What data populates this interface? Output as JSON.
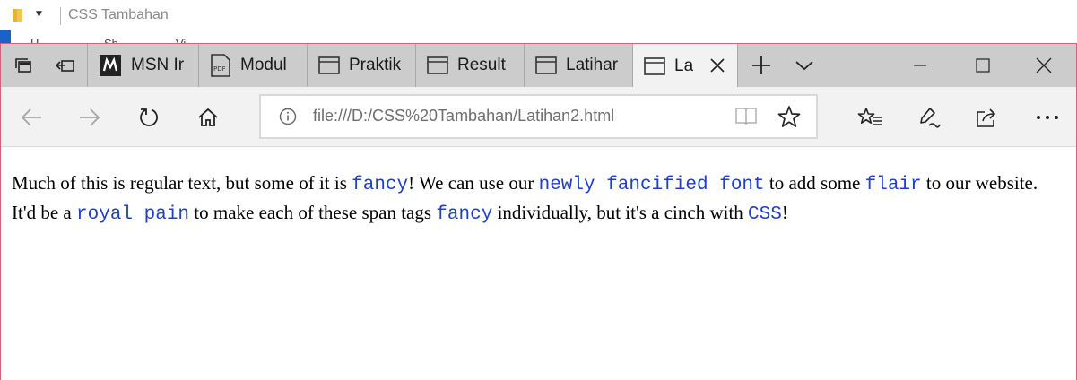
{
  "explorer": {
    "title": "CSS Tambahan",
    "ribbon_peek": [
      "H",
      "Sh",
      "Vi"
    ]
  },
  "tabs": [
    {
      "title": "MSN Ir",
      "icon": "msn-icon"
    },
    {
      "title": "Modul",
      "icon": "pdf-icon"
    },
    {
      "title": "Praktik",
      "icon": "page-icon"
    },
    {
      "title": "Result",
      "icon": "page-icon"
    },
    {
      "title": "Latihar",
      "icon": "page-icon"
    },
    {
      "title": "La",
      "icon": "page-icon",
      "active": true
    }
  ],
  "address": {
    "url": "file:///D:/CSS%20Tambahan/Latihan2.html"
  },
  "content": {
    "s1": "Much of this is regular text, but some of it is ",
    "f1": "fancy",
    "s2": "! We can use our ",
    "f2": "newly fancified font",
    "s3": " to add some ",
    "f3": "flair",
    "s4": " to our website. It'd be a ",
    "f4": "royal pain",
    "s5": " to make each of these span tags ",
    "f5": "fancy",
    "s6": " individually, but it's a cinch with ",
    "f6": "CSS",
    "s7": "!"
  },
  "colors": {
    "fancy_text": "#1f3fc4",
    "tabbar": "#cccccc",
    "toolbar": "#f2f2f2",
    "window_border": "#d4627a"
  }
}
